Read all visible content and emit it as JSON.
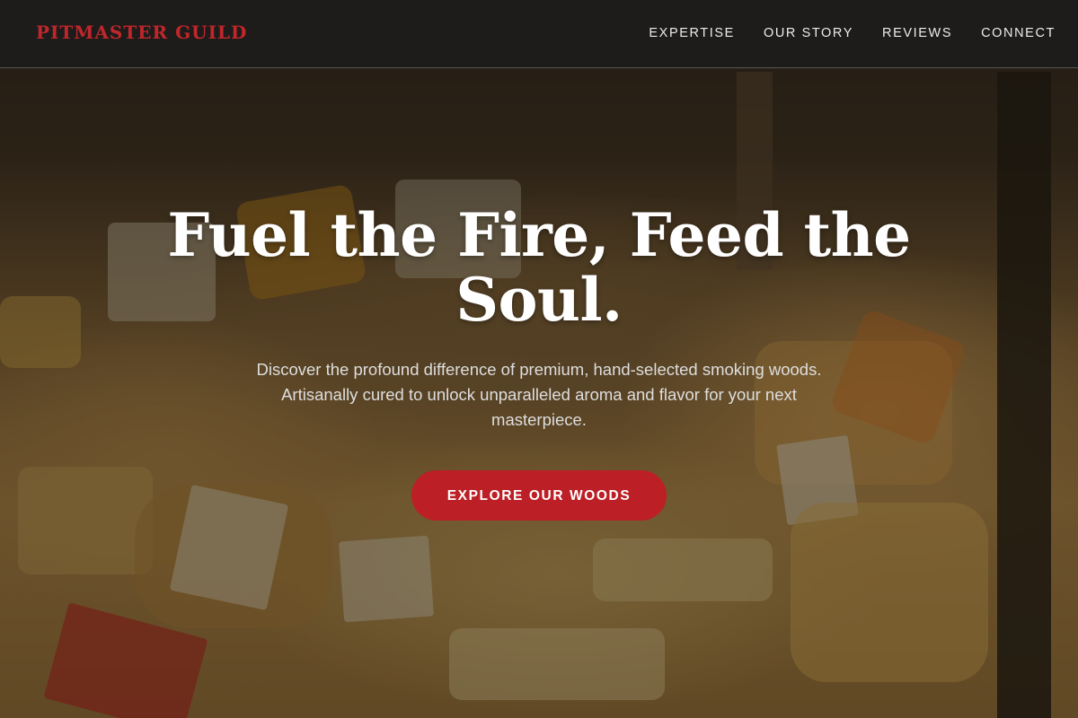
{
  "brand": {
    "name": "PITMASTER GUILD",
    "accent_color": "#bc1f26"
  },
  "nav": {
    "links": [
      {
        "label": "EXPERTISE"
      },
      {
        "label": "OUR STORY"
      },
      {
        "label": "REVIEWS"
      },
      {
        "label": "CONNECT"
      }
    ]
  },
  "hero": {
    "title": "Fuel the Fire, Feed the Soul.",
    "subtitle": "Discover the profound difference of premium, hand-selected smoking woods. Artisanally cured to unlock unparalleled aroma and flavor for your next masterpiece.",
    "cta_label": "EXPLORE OUR WOODS",
    "background_image": "cheese-display-photo"
  }
}
